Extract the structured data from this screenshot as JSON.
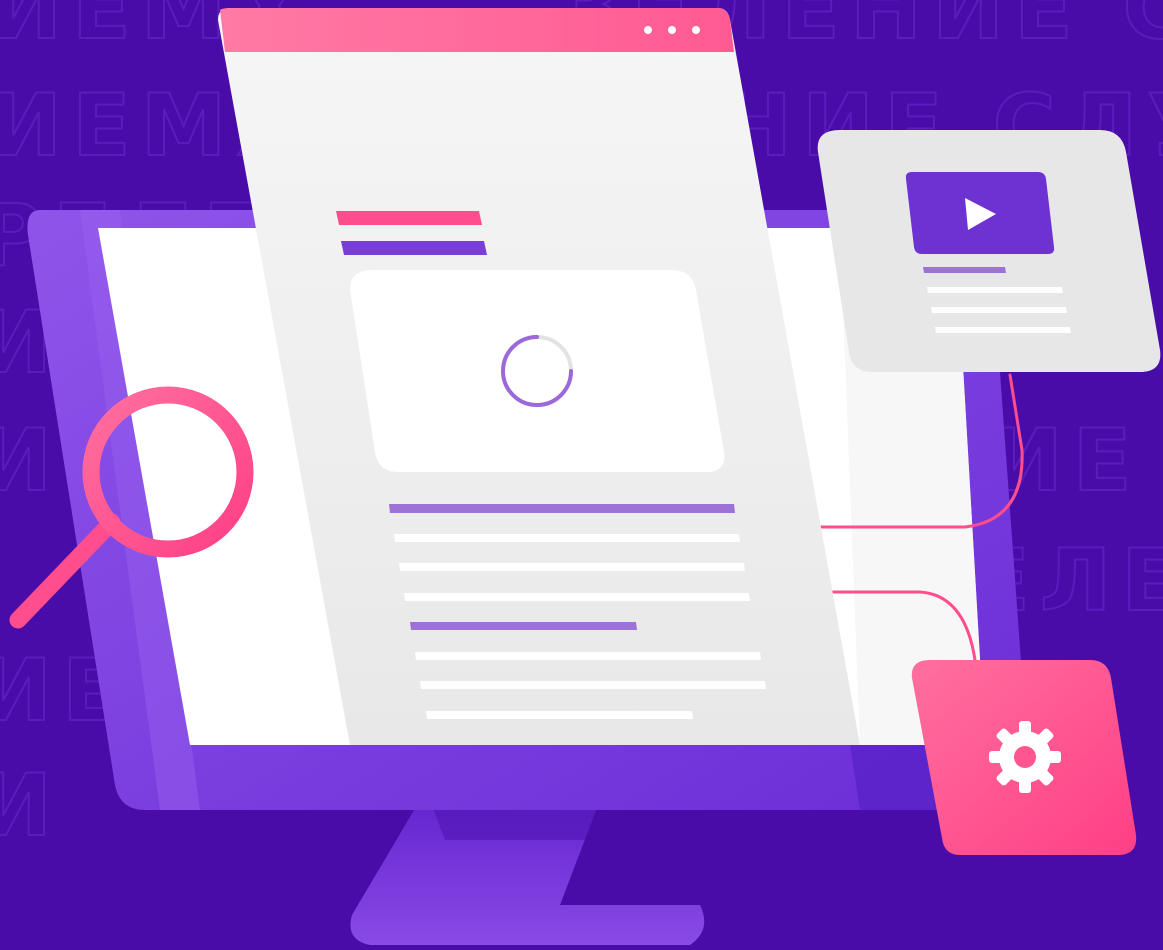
{
  "background": {
    "color": "#4a0ca8",
    "watermark_lines": [
      "ИЕМХ",
      "ЗЕЛЕНИЕ СЛУ",
      "ИЕМХ",
      "НИЕ СЛУ",
      "РЕЛЕН",
      "И",
      "ЕНИЕ СЛУ",
      "ЗЕЛЕН",
      "ИЕ",
      "ИЕ",
      "И"
    ]
  },
  "colors": {
    "pink": "#ff4d8d",
    "pink_light": "#ff6e9c",
    "purple": "#7a3ed8",
    "purple_dark": "#5a1fc4",
    "panel": "#ececec",
    "white": "#ffffff"
  },
  "browser_window": {
    "titlebar_dots": 3,
    "loading_progress": 0.75
  },
  "icons": {
    "search": "magnifier-icon",
    "video": "play-icon",
    "settings": "gear-icon",
    "loading": "spinner-icon"
  }
}
